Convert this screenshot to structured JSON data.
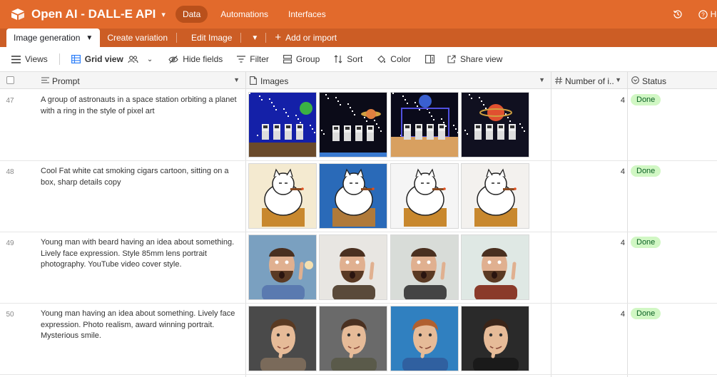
{
  "app": {
    "title": "Open AI - DALL-E API",
    "nav": {
      "data": "Data",
      "automations": "Automations",
      "interfaces": "Interfaces"
    },
    "help": "He"
  },
  "tabs": {
    "active": "Image generation",
    "items": [
      "Create variation",
      "Edit Image"
    ],
    "add": "Add or import"
  },
  "toolbar": {
    "views": "Views",
    "grid_view": "Grid view",
    "hide_fields": "Hide fields",
    "filter": "Filter",
    "group": "Group",
    "sort": "Sort",
    "color": "Color",
    "share": "Share view"
  },
  "columns": {
    "prompt": "Prompt",
    "images": "Images",
    "number": "Number of i...",
    "status": "Status"
  },
  "rows": [
    {
      "num": "47",
      "prompt": "A group of astronauts in a space station orbiting a planet with a ring in the style of pixel art",
      "count": "4",
      "status": "Done",
      "images": [
        "pixel-astronauts-image-1",
        "pixel-astronauts-image-2",
        "pixel-astronauts-image-3",
        "pixel-astronauts-image-4"
      ]
    },
    {
      "num": "48",
      "prompt": "Cool Fat white cat smoking cigars cartoon, sitting on a box, sharp details copy",
      "count": "4",
      "status": "Done",
      "images": [
        "cartoon-cat-image-1",
        "cartoon-cat-image-2",
        "cartoon-cat-image-3",
        "cartoon-cat-image-4"
      ]
    },
    {
      "num": "49",
      "prompt": "Young man with beard having an idea about something. Lively face expression. Style 85mm lens portrait photography. YouTube video cover style.",
      "count": "4",
      "status": "Done",
      "images": [
        "bearded-man-photo-1",
        "bearded-man-photo-2",
        "bearded-man-photo-3",
        "bearded-man-photo-4"
      ]
    },
    {
      "num": "50",
      "prompt": "Young man having an idea about something. Lively face expression.  Photo realism, award winning portrait. Mysterious smile.",
      "count": "4",
      "status": "Done",
      "images": [
        "young-man-portrait-1",
        "young-man-portrait-2",
        "young-man-portrait-3",
        "young-man-portrait-4"
      ]
    }
  ],
  "colors": {
    "appbar": "#e26a2c",
    "tabbar": "#cc5d25",
    "status_bg": "#d1f7c4",
    "status_text": "#0b6124"
  }
}
